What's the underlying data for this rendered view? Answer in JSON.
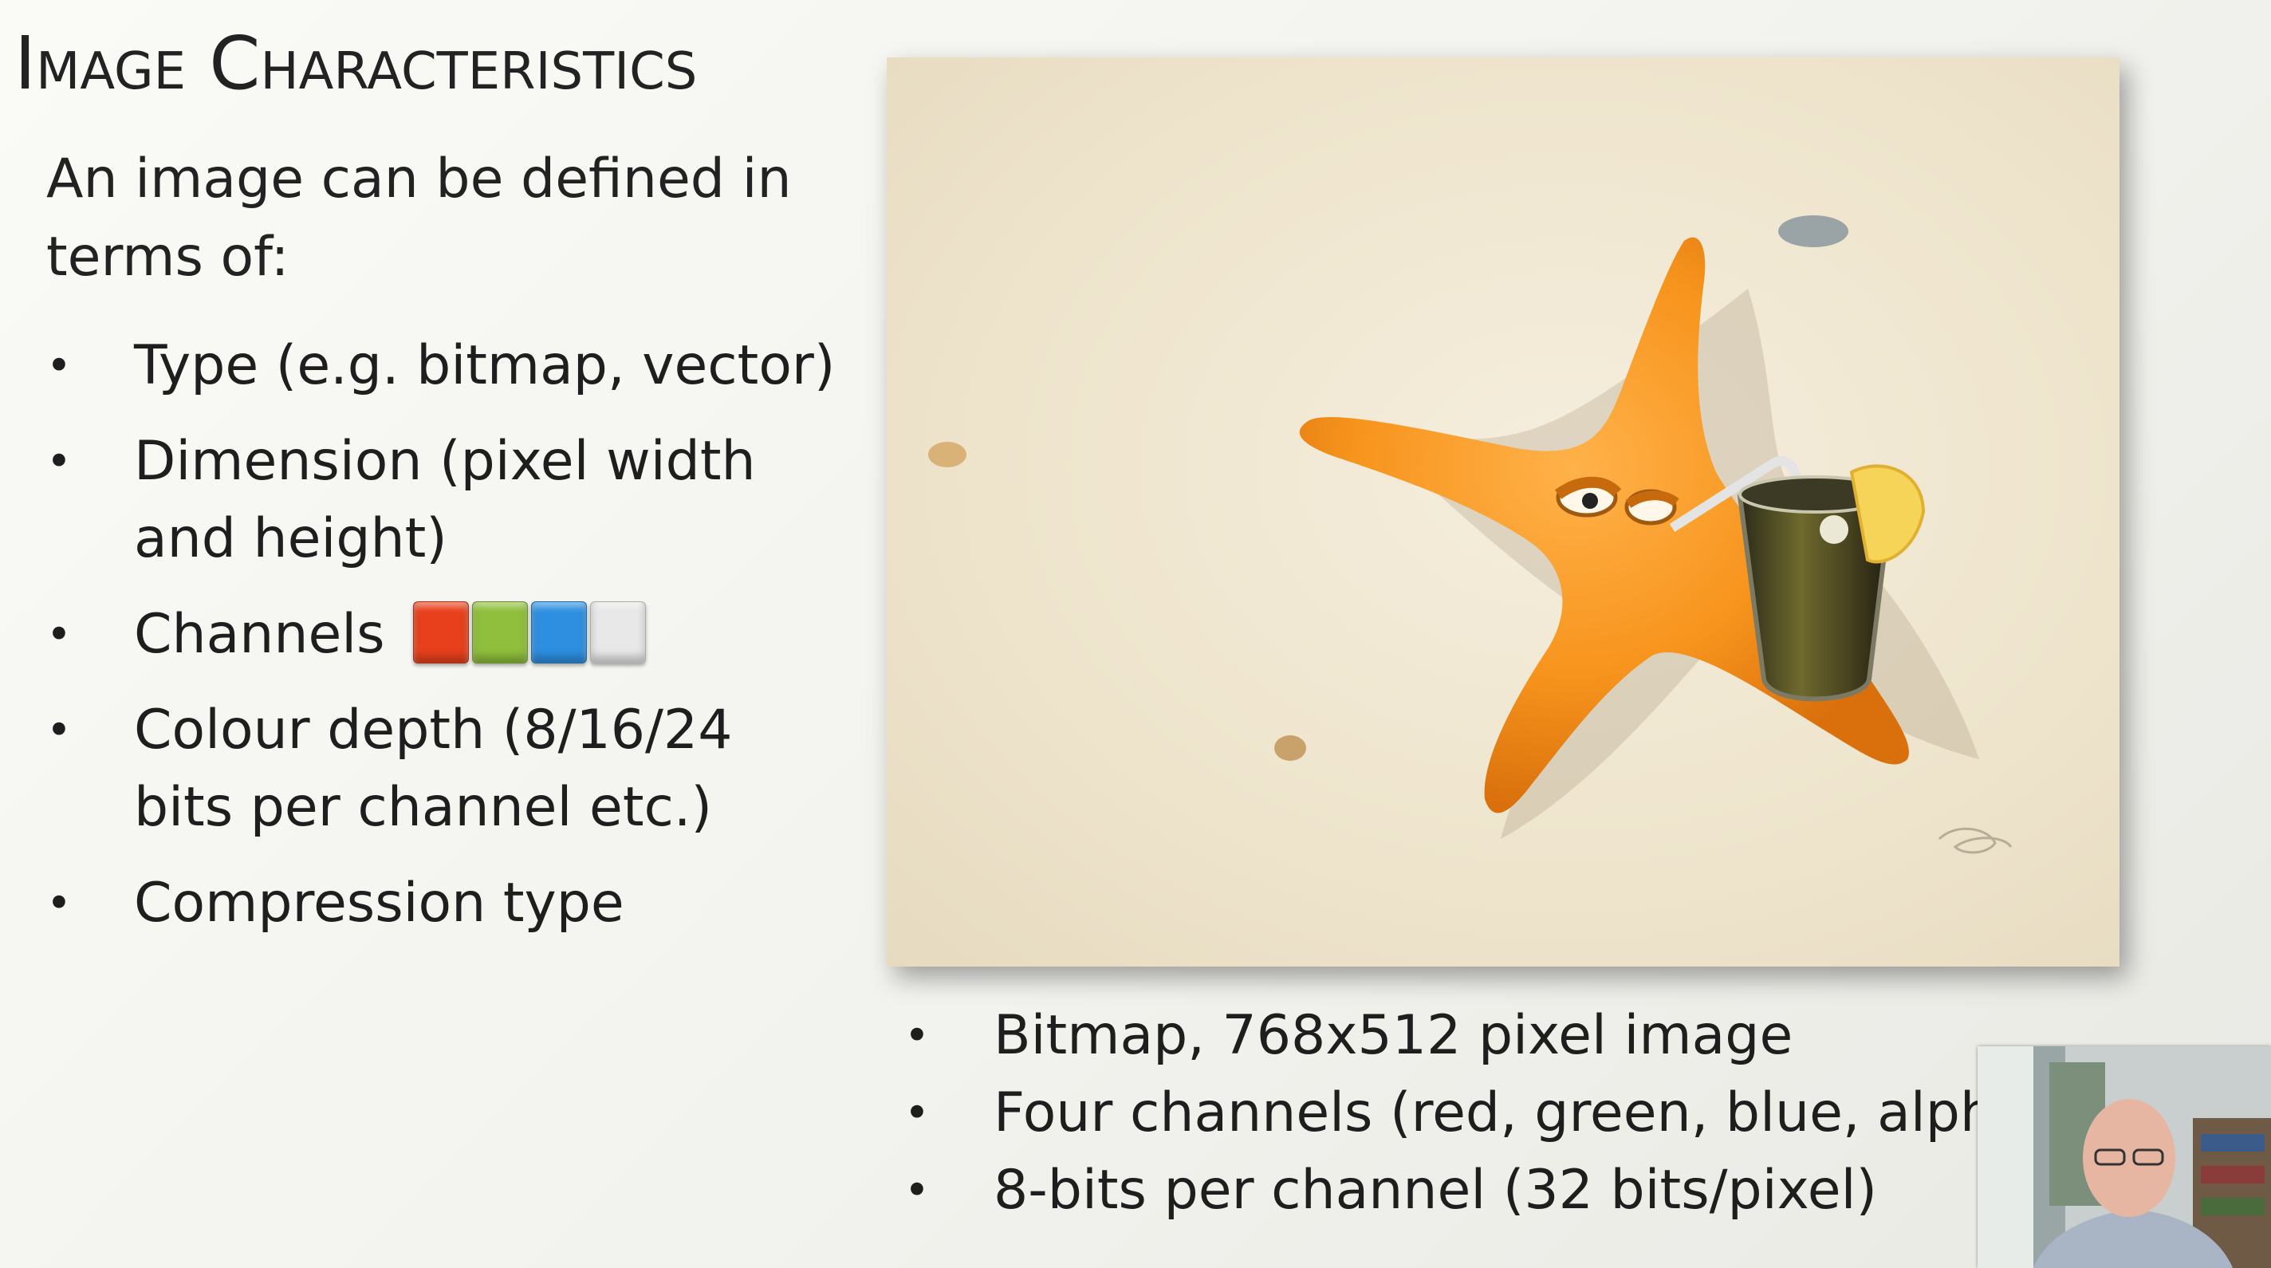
{
  "slide": {
    "title": "Image Characteristics",
    "intro": "An image can be defined in terms of:",
    "left_bullets": [
      "Type (e.g. bitmap, vector)",
      "Dimension (pixel width and height)",
      "Channels",
      "Colour depth (8/16/24 bits per channel etc.)",
      "Compression type"
    ],
    "bullet_symbol": "•",
    "channel_colors": {
      "red": "#e8401c",
      "green": "#8fbf3c",
      "blue": "#2e8fe0",
      "white": "#e8e8e8"
    },
    "image": {
      "description_icon": "starfish-with-drink-image"
    },
    "right_bullets": [
      "Bitmap, 768x512 pixel image",
      "Four channels (red, green, blue, alpha",
      "8-bits per channel (32 bits/pixel)"
    ]
  },
  "webcam": {
    "icon": "presenter-webcam"
  }
}
